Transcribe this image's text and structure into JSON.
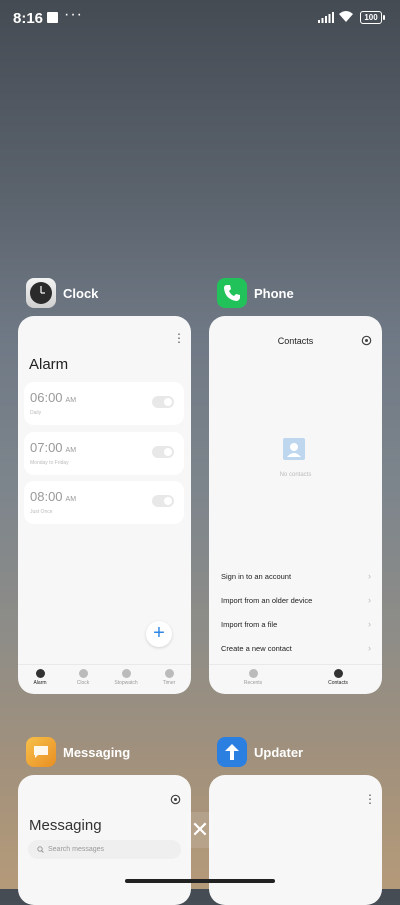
{
  "status": {
    "time": "8:16",
    "more": "···",
    "battery": "100"
  },
  "apps": {
    "clock": {
      "name": "Clock",
      "screen_title": "Alarm",
      "alarms": [
        {
          "time": "06:00",
          "ampm": "AM",
          "sub": "Daily"
        },
        {
          "time": "07:00",
          "ampm": "AM",
          "sub": "Monday to Friday"
        },
        {
          "time": "08:00",
          "ampm": "AM",
          "sub": "Just Once"
        }
      ],
      "fab": "+",
      "nav": [
        "Alarm",
        "Clock",
        "Stopwatch",
        "Timer"
      ]
    },
    "phone": {
      "name": "Phone",
      "screen_title": "Contacts",
      "empty": "No contacts",
      "options": [
        "Sign in to an account",
        "Import from an older device",
        "Import from a file",
        "Create a new contact"
      ],
      "nav": [
        "Recents",
        "Contacts"
      ]
    },
    "messaging": {
      "name": "Messaging",
      "screen_title": "Messaging",
      "search_placeholder": "Search messages"
    },
    "updater": {
      "name": "Updater"
    }
  },
  "close": "✕"
}
